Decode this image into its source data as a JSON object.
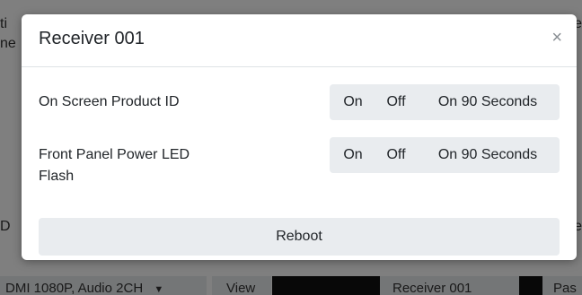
{
  "background": {
    "left_fragments": [
      "ti",
      "ne",
      "D"
    ],
    "right_fragments": [
      "fe",
      "e"
    ],
    "bottom_bar": {
      "select_text": "DMI 1080P, Audio 2CH",
      "view_label": "View",
      "receiver_label": "Receiver 001",
      "pas_label": "Pas"
    }
  },
  "modal": {
    "title": "Receiver 001",
    "close_glyph": "×",
    "rows": [
      {
        "label": "On Screen Product ID",
        "options": [
          "On",
          "Off",
          "On 90 Seconds"
        ]
      },
      {
        "label": "Front Panel Power LED Flash",
        "options": [
          "On",
          "Off",
          "On 90 Seconds"
        ]
      }
    ],
    "reboot_label": "Reboot"
  },
  "icons": {
    "close": "close-icon",
    "select_caret": "caret-down-icon"
  },
  "colors": {
    "button_bg": "#e9ecef",
    "text": "#212529",
    "backdrop": "rgba(0,0,0,0.5)"
  }
}
